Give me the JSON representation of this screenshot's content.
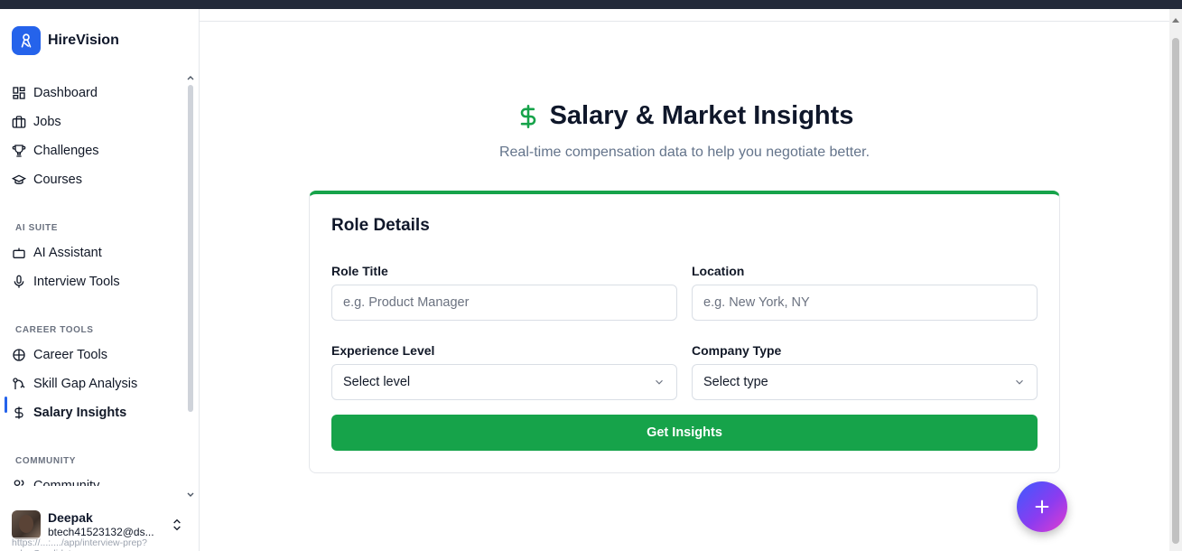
{
  "brand": {
    "name": "HireVision"
  },
  "sidebar": {
    "main_items": [
      {
        "label": "Dashboard",
        "icon": "dashboard-icon"
      },
      {
        "label": "Jobs",
        "icon": "briefcase-icon"
      },
      {
        "label": "Challenges",
        "icon": "trophy-icon"
      },
      {
        "label": "Courses",
        "icon": "graduation-cap-icon"
      }
    ],
    "sections": [
      {
        "label": "AI SUITE",
        "items": [
          {
            "label": "AI Assistant",
            "icon": "bot-icon"
          },
          {
            "label": "Interview Tools",
            "icon": "microphone-icon"
          }
        ]
      },
      {
        "label": "CAREER TOOLS",
        "items": [
          {
            "label": "Career Tools",
            "icon": "brain-icon"
          },
          {
            "label": "Skill Gap Analysis",
            "icon": "network-icon"
          },
          {
            "label": "Salary Insights",
            "icon": "dollar-icon",
            "active": true
          }
        ]
      },
      {
        "label": "COMMUNITY",
        "items": [
          {
            "label": "Community",
            "icon": "users-icon"
          }
        ]
      }
    ],
    "user": {
      "name": "Deepak",
      "email": "btech41523132@ds..."
    },
    "status_url": "https://...:..../app/interview-prep?role=Candidate"
  },
  "main": {
    "title": "Salary & Market Insights",
    "subtitle": "Real-time compensation data to help you negotiate better.",
    "card": {
      "title": "Role Details",
      "role_title": {
        "label": "Role Title",
        "placeholder": "e.g. Product Manager"
      },
      "location": {
        "label": "Location",
        "placeholder": "e.g. New York, NY"
      },
      "experience": {
        "label": "Experience Level",
        "value": "Select level"
      },
      "company_type": {
        "label": "Company Type",
        "value": "Select type"
      },
      "submit_label": "Get Insights"
    }
  },
  "colors": {
    "accent": "#16a34a",
    "brand": "#2563eb",
    "fab_start": "#3b5bff",
    "fab_end": "#e23ccf"
  }
}
